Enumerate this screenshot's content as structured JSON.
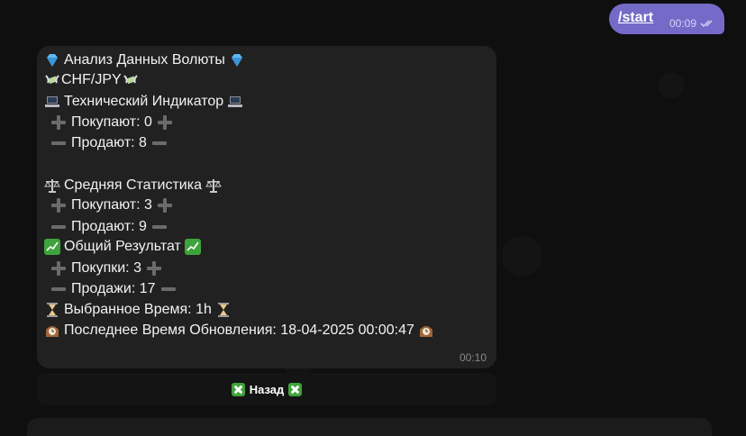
{
  "outgoing": {
    "text": "/start",
    "time": "00:09"
  },
  "message": {
    "lines": [
      "Анализ Данных Волюты",
      "CHF/JPY",
      "Технический Индикатор",
      "Покупают: 0",
      "Продают: 8",
      "Средняя Статистика",
      "Покупают: 3",
      "Продают: 9",
      "Общий Результат",
      "Покупки: 3",
      "Продажи: 17",
      "Выбранное Время: 1h",
      "Последнее Время Обновления: 18-04-2025 00:00:47"
    ],
    "time": "00:10"
  },
  "keyboard": {
    "back_label": "Назад"
  },
  "icons": {
    "diamond": "diamond-icon",
    "money": "money-with-wings-icon",
    "laptop": "laptop-icon",
    "plus": "heavy-plus-icon",
    "minus": "heavy-minus-icon",
    "scales": "balance-scale-icon",
    "chart": "chart-yen-icon",
    "hourglass": "hourglass-icon",
    "clock": "mantelpiece-clock-icon",
    "cross": "cross-mark-button-icon",
    "read": "double-check-icon"
  },
  "colors": {
    "accent": "#766ac8",
    "bubble": "#212121",
    "background": "#0f0f10"
  }
}
